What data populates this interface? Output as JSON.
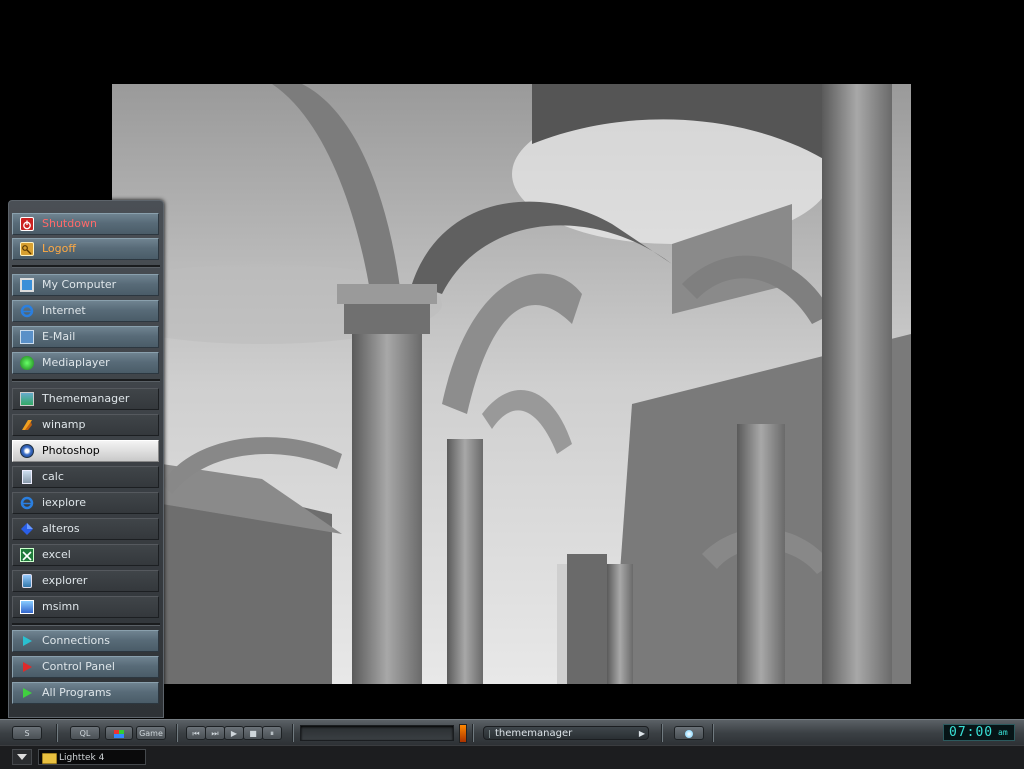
{
  "start_menu": {
    "system_items": [
      {
        "label": "Shutdown",
        "icon": "shutdown-icon"
      },
      {
        "label": "Logoff",
        "icon": "key-icon"
      }
    ],
    "places": [
      {
        "label": "My Computer",
        "icon": "computer-icon"
      },
      {
        "label": "Internet",
        "icon": "internet-explorer-icon"
      },
      {
        "label": "E-Mail",
        "icon": "email-icon"
      },
      {
        "label": "Mediaplayer",
        "icon": "mediaplayer-icon"
      }
    ],
    "programs": [
      {
        "label": "Thememanager",
        "icon": "thememanager-icon"
      },
      {
        "label": "winamp",
        "icon": "winamp-icon"
      },
      {
        "label": "Photoshop",
        "icon": "photoshop-icon"
      },
      {
        "label": "calc",
        "icon": "calculator-icon"
      },
      {
        "label": "iexplore",
        "icon": "internet-explorer-icon"
      },
      {
        "label": "alteros",
        "icon": "alteros-icon"
      },
      {
        "label": "excel",
        "icon": "excel-icon"
      },
      {
        "label": "explorer",
        "icon": "explorer-icon"
      },
      {
        "label": "msimn",
        "icon": "outlook-express-icon"
      }
    ],
    "submenus": [
      {
        "label": "Connections",
        "icon": "arrow-right-icon"
      },
      {
        "label": "Control Panel",
        "icon": "arrow-right-icon"
      },
      {
        "label": "All Programs",
        "icon": "arrow-right-icon"
      }
    ]
  },
  "taskbar": {
    "start_label": "S",
    "quicklaunch_label": "QL",
    "game_label": "Game",
    "media_controls": [
      "prev-icon",
      "next-icon",
      "play-icon",
      "stop-icon",
      "pause-icon"
    ],
    "theme_selector_value": "thememanager",
    "clock": {
      "time": "07:00",
      "meridiem": "am"
    }
  },
  "bottom_bar": {
    "task_label": "Lighttek 4"
  },
  "colors": {
    "shutdown_text": "#ff6a6a",
    "logoff_text": "#ffaa44",
    "clock_text": "#39e0d6",
    "menu_blue": "#586b78",
    "menu_dark": "#383c40"
  }
}
